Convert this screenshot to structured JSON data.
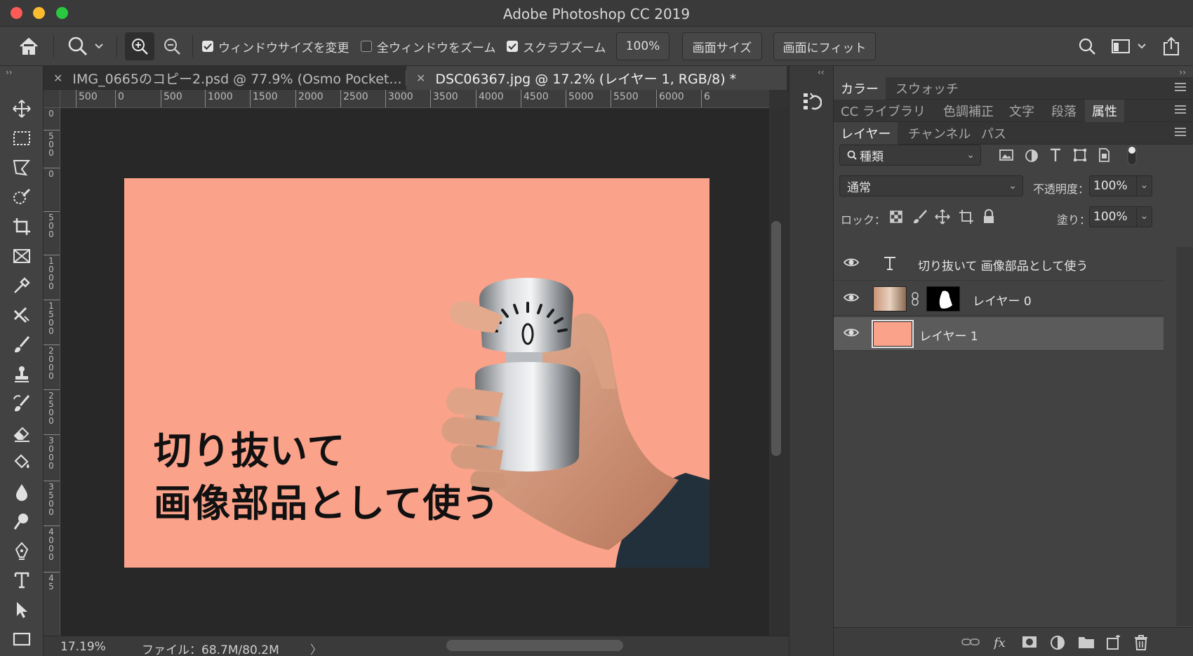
{
  "window": {
    "title": "Adobe Photoshop CC 2019"
  },
  "options": {
    "checkbox_resize": "ウィンドウサイズを変更",
    "checkbox_zoom_all": "全ウィンドウをズーム",
    "checkbox_scrubby": "スクラブズーム",
    "zoom_value": "100%",
    "btn_canvas_size": "画面サイズ",
    "btn_fit_screen": "画面にフィット"
  },
  "tabs": [
    {
      "label": "IMG_0665のコピー2.psd @ 77.9% (Osmo Pocket...",
      "active": false
    },
    {
      "label": "DSC06367.jpg @ 17.2% (レイヤー 1, RGB/8) *",
      "active": true
    }
  ],
  "ruler_top": [
    "500",
    "0",
    "500",
    "1000",
    "1500",
    "2000",
    "2500",
    "3000",
    "3500",
    "4000",
    "4500",
    "5000",
    "5500",
    "6000",
    "6"
  ],
  "ruler_left": [
    "0",
    "500",
    "0",
    "500",
    "1000",
    "1500",
    "2000",
    "2500",
    "3000",
    "3500",
    "4000",
    "45"
  ],
  "document": {
    "line1": "切り抜いて",
    "line2": "画像部品として使う",
    "background_color": "#fba28a"
  },
  "status": {
    "zoom": "17.19%",
    "file": "ファイル：68.7M/80.2M",
    "arrow": "〉"
  },
  "panels": {
    "row1": [
      "カラー",
      "スウォッチ"
    ],
    "row2": [
      "CC ライブラリ",
      "色調補正",
      "文字",
      "段落",
      "属性"
    ],
    "row3": [
      "レイヤー",
      "チャンネル",
      "パス"
    ]
  },
  "layers_panel": {
    "filter_label": "種類",
    "blend_mode": "通常",
    "opacity_label": "不透明度：",
    "opacity_value": "100%",
    "lock_label": "ロック：",
    "fill_label": "塗り：",
    "fill_value": "100%",
    "layers": [
      {
        "name": "切り抜いて 画像部品として使う",
        "type": "text",
        "visible": true,
        "selected": false
      },
      {
        "name": "レイヤー 0",
        "type": "image-with-mask",
        "visible": true,
        "selected": false
      },
      {
        "name": "レイヤー 1",
        "type": "fill",
        "visible": true,
        "selected": true
      }
    ]
  },
  "colors": {
    "accent_fill": "#fba28a",
    "panel_bg": "#424242",
    "canvas_bg": "#282828"
  }
}
